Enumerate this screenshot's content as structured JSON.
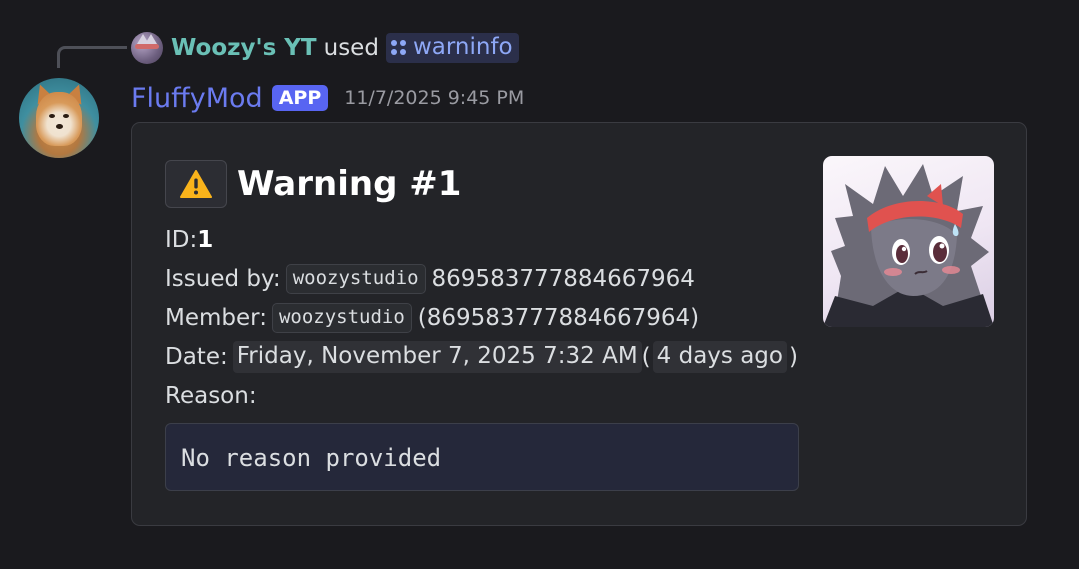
{
  "reply": {
    "username": "Woozy's YT",
    "used_text": "used",
    "command_name": "warninfo",
    "avatar_icon": "user-avatar-icon",
    "command_icon": "slash-command-icon"
  },
  "message": {
    "username": "FluffyMod",
    "badge": "APP",
    "timestamp": "11/7/2025 9:45 PM",
    "avatar_icon": "corgi-avatar-icon"
  },
  "embed": {
    "title": "Warning #1",
    "title_icon": "warning-icon",
    "id_label": "ID: ",
    "id_value": "1",
    "issued_by_label": "Issued by: ",
    "issued_by_user": "woozystudio",
    "issued_by_id": "869583777884667964",
    "member_label": "Member: ",
    "member_user": "woozystudio",
    "member_id": "(869583777884667964)",
    "date_label": "Date: ",
    "date_value": "Friday, November 7, 2025 7:32 AM",
    "date_open_paren": "(",
    "date_relative": "4 days ago",
    "date_close_paren": ")",
    "reason_label": "Reason:",
    "reason_value": "No reason provided",
    "thumbnail_icon": "character-thumbnail-image"
  },
  "colors": {
    "background": "#1a1a1e",
    "embed_background": "#232428",
    "reply_username": "#6ac0b6",
    "bot_username": "#6b7bf0",
    "app_badge": "#5865f2",
    "command_text": "#8ea8f6"
  }
}
